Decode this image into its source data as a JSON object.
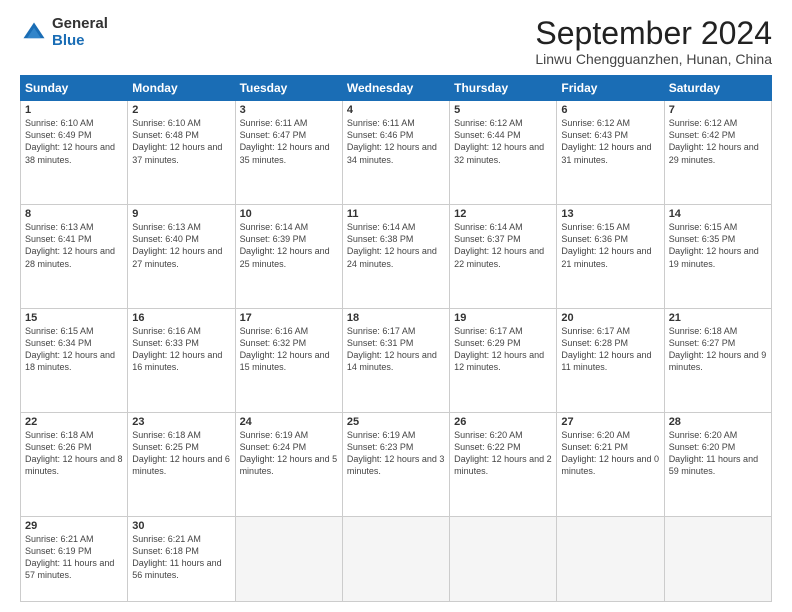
{
  "logo": {
    "general": "General",
    "blue": "Blue"
  },
  "title": {
    "month_year": "September 2024",
    "location": "Linwu Chengguanzhen, Hunan, China"
  },
  "weekdays": [
    "Sunday",
    "Monday",
    "Tuesday",
    "Wednesday",
    "Thursday",
    "Friday",
    "Saturday"
  ],
  "weeks": [
    [
      {
        "day": "1",
        "sunrise": "Sunrise: 6:10 AM",
        "sunset": "Sunset: 6:49 PM",
        "daylight": "Daylight: 12 hours and 38 minutes."
      },
      {
        "day": "2",
        "sunrise": "Sunrise: 6:10 AM",
        "sunset": "Sunset: 6:48 PM",
        "daylight": "Daylight: 12 hours and 37 minutes."
      },
      {
        "day": "3",
        "sunrise": "Sunrise: 6:11 AM",
        "sunset": "Sunset: 6:47 PM",
        "daylight": "Daylight: 12 hours and 35 minutes."
      },
      {
        "day": "4",
        "sunrise": "Sunrise: 6:11 AM",
        "sunset": "Sunset: 6:46 PM",
        "daylight": "Daylight: 12 hours and 34 minutes."
      },
      {
        "day": "5",
        "sunrise": "Sunrise: 6:12 AM",
        "sunset": "Sunset: 6:44 PM",
        "daylight": "Daylight: 12 hours and 32 minutes."
      },
      {
        "day": "6",
        "sunrise": "Sunrise: 6:12 AM",
        "sunset": "Sunset: 6:43 PM",
        "daylight": "Daylight: 12 hours and 31 minutes."
      },
      {
        "day": "7",
        "sunrise": "Sunrise: 6:12 AM",
        "sunset": "Sunset: 6:42 PM",
        "daylight": "Daylight: 12 hours and 29 minutes."
      }
    ],
    [
      {
        "day": "8",
        "sunrise": "Sunrise: 6:13 AM",
        "sunset": "Sunset: 6:41 PM",
        "daylight": "Daylight: 12 hours and 28 minutes."
      },
      {
        "day": "9",
        "sunrise": "Sunrise: 6:13 AM",
        "sunset": "Sunset: 6:40 PM",
        "daylight": "Daylight: 12 hours and 27 minutes."
      },
      {
        "day": "10",
        "sunrise": "Sunrise: 6:14 AM",
        "sunset": "Sunset: 6:39 PM",
        "daylight": "Daylight: 12 hours and 25 minutes."
      },
      {
        "day": "11",
        "sunrise": "Sunrise: 6:14 AM",
        "sunset": "Sunset: 6:38 PM",
        "daylight": "Daylight: 12 hours and 24 minutes."
      },
      {
        "day": "12",
        "sunrise": "Sunrise: 6:14 AM",
        "sunset": "Sunset: 6:37 PM",
        "daylight": "Daylight: 12 hours and 22 minutes."
      },
      {
        "day": "13",
        "sunrise": "Sunrise: 6:15 AM",
        "sunset": "Sunset: 6:36 PM",
        "daylight": "Daylight: 12 hours and 21 minutes."
      },
      {
        "day": "14",
        "sunrise": "Sunrise: 6:15 AM",
        "sunset": "Sunset: 6:35 PM",
        "daylight": "Daylight: 12 hours and 19 minutes."
      }
    ],
    [
      {
        "day": "15",
        "sunrise": "Sunrise: 6:15 AM",
        "sunset": "Sunset: 6:34 PM",
        "daylight": "Daylight: 12 hours and 18 minutes."
      },
      {
        "day": "16",
        "sunrise": "Sunrise: 6:16 AM",
        "sunset": "Sunset: 6:33 PM",
        "daylight": "Daylight: 12 hours and 16 minutes."
      },
      {
        "day": "17",
        "sunrise": "Sunrise: 6:16 AM",
        "sunset": "Sunset: 6:32 PM",
        "daylight": "Daylight: 12 hours and 15 minutes."
      },
      {
        "day": "18",
        "sunrise": "Sunrise: 6:17 AM",
        "sunset": "Sunset: 6:31 PM",
        "daylight": "Daylight: 12 hours and 14 minutes."
      },
      {
        "day": "19",
        "sunrise": "Sunrise: 6:17 AM",
        "sunset": "Sunset: 6:29 PM",
        "daylight": "Daylight: 12 hours and 12 minutes."
      },
      {
        "day": "20",
        "sunrise": "Sunrise: 6:17 AM",
        "sunset": "Sunset: 6:28 PM",
        "daylight": "Daylight: 12 hours and 11 minutes."
      },
      {
        "day": "21",
        "sunrise": "Sunrise: 6:18 AM",
        "sunset": "Sunset: 6:27 PM",
        "daylight": "Daylight: 12 hours and 9 minutes."
      }
    ],
    [
      {
        "day": "22",
        "sunrise": "Sunrise: 6:18 AM",
        "sunset": "Sunset: 6:26 PM",
        "daylight": "Daylight: 12 hours and 8 minutes."
      },
      {
        "day": "23",
        "sunrise": "Sunrise: 6:18 AM",
        "sunset": "Sunset: 6:25 PM",
        "daylight": "Daylight: 12 hours and 6 minutes."
      },
      {
        "day": "24",
        "sunrise": "Sunrise: 6:19 AM",
        "sunset": "Sunset: 6:24 PM",
        "daylight": "Daylight: 12 hours and 5 minutes."
      },
      {
        "day": "25",
        "sunrise": "Sunrise: 6:19 AM",
        "sunset": "Sunset: 6:23 PM",
        "daylight": "Daylight: 12 hours and 3 minutes."
      },
      {
        "day": "26",
        "sunrise": "Sunrise: 6:20 AM",
        "sunset": "Sunset: 6:22 PM",
        "daylight": "Daylight: 12 hours and 2 minutes."
      },
      {
        "day": "27",
        "sunrise": "Sunrise: 6:20 AM",
        "sunset": "Sunset: 6:21 PM",
        "daylight": "Daylight: 12 hours and 0 minutes."
      },
      {
        "day": "28",
        "sunrise": "Sunrise: 6:20 AM",
        "sunset": "Sunset: 6:20 PM",
        "daylight": "Daylight: 11 hours and 59 minutes."
      }
    ],
    [
      {
        "day": "29",
        "sunrise": "Sunrise: 6:21 AM",
        "sunset": "Sunset: 6:19 PM",
        "daylight": "Daylight: 11 hours and 57 minutes."
      },
      {
        "day": "30",
        "sunrise": "Sunrise: 6:21 AM",
        "sunset": "Sunset: 6:18 PM",
        "daylight": "Daylight: 11 hours and 56 minutes."
      },
      null,
      null,
      null,
      null,
      null
    ]
  ]
}
